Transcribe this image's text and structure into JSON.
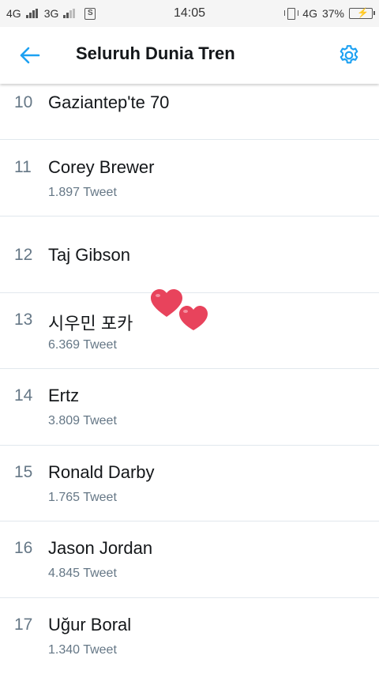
{
  "status_bar": {
    "network1": "4G",
    "network2": "3G",
    "time": "14:05",
    "network3": "4G",
    "battery": "37%",
    "icons": [
      "signal-icon",
      "sim-icon",
      "vibrate-icon",
      "battery-charging-icon"
    ]
  },
  "header": {
    "title": "Seluruh Dunia Tren",
    "back_icon": "arrow-left-icon",
    "settings_icon": "gear-icon",
    "accent_color": "#1da1f2"
  },
  "trends": [
    {
      "rank": "10",
      "name": "Gaziantep'te 70",
      "count": ""
    },
    {
      "rank": "11",
      "name": "Corey Brewer",
      "count": "1.897 Tweet"
    },
    {
      "rank": "12",
      "name": "Taj Gibson",
      "count": ""
    },
    {
      "rank": "13",
      "name": "시우민 포카",
      "count": "6.369 Tweet"
    },
    {
      "rank": "14",
      "name": "Ertz",
      "count": "3.809 Tweet"
    },
    {
      "rank": "15",
      "name": "Ronald Darby",
      "count": "1.765 Tweet"
    },
    {
      "rank": "16",
      "name": "Jason Jordan",
      "count": "4.845 Tweet"
    },
    {
      "rank": "17",
      "name": "Uğur Boral",
      "count": "1.340 Tweet"
    }
  ],
  "decoration": {
    "icon": "hearts-sticker-icon",
    "color": "#e8435c"
  }
}
